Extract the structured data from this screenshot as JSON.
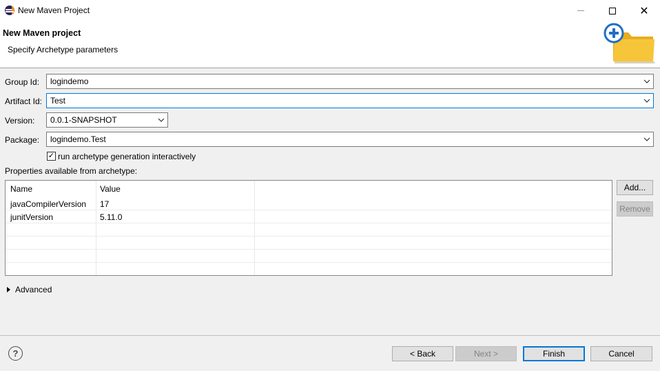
{
  "window": {
    "title": "New Maven Project"
  },
  "header": {
    "title": "New Maven project",
    "subtitle": "Specify Archetype parameters",
    "icon": "new-maven-folder-icon"
  },
  "form": {
    "group_id": {
      "label": "Group Id:",
      "value": "logindemo"
    },
    "artifact_id": {
      "label": "Artifact Id:",
      "value": "Test"
    },
    "version": {
      "label": "Version:",
      "value": "0.0.1-SNAPSHOT"
    },
    "package": {
      "label": "Package:",
      "value": "logindemo.Test"
    },
    "interactive": {
      "label": "run archetype generation interactively",
      "checked": true
    }
  },
  "properties": {
    "label": "Properties available from archetype:",
    "columns": [
      "Name",
      "Value"
    ],
    "rows": [
      {
        "name": "javaCompilerVersion",
        "value": "17"
      },
      {
        "name": "junitVersion",
        "value": "5.11.0"
      }
    ],
    "add_label": "Add...",
    "remove_label": "Remove"
  },
  "advanced": {
    "label": "Advanced"
  },
  "footer": {
    "help": "?",
    "back_label": "< Back",
    "next_label": "Next >",
    "finish_label": "Finish",
    "cancel_label": "Cancel"
  },
  "colors": {
    "accent": "#0078d7",
    "folder": "#f6c53a",
    "plus": "#1f6fc5"
  }
}
